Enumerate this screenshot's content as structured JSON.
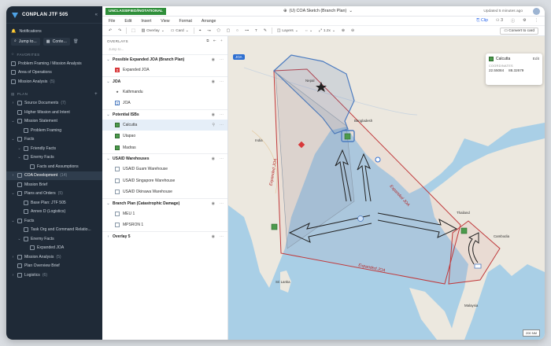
{
  "sidebar": {
    "title": "CONPLAN JTF 505",
    "notifications": "Notifications",
    "jump_to": "Jump to...",
    "context_btn": "Conte...",
    "favorites_label": "FAVORITES",
    "favorites": [
      {
        "label": "Problem Framing / Mission Analysis",
        "count": ""
      },
      {
        "label": "Area of Operations",
        "count": ""
      },
      {
        "label": "Mission Analysis",
        "count": "(5)"
      }
    ],
    "plan_label": "PLAN",
    "tree": [
      {
        "label": "Source Documents",
        "count": "(7)",
        "indent": 0,
        "chev": "›"
      },
      {
        "label": "Higher Mission and Intent",
        "count": "",
        "indent": 0,
        "chev": ""
      },
      {
        "label": "Mission Statement",
        "count": "",
        "indent": 0,
        "chev": "⌄"
      },
      {
        "label": "Problem Framing",
        "count": "",
        "indent": 1,
        "chev": ""
      },
      {
        "label": "Facts",
        "count": "",
        "indent": 0,
        "chev": "⌄"
      },
      {
        "label": "Friendly Facts",
        "count": "",
        "indent": 1,
        "chev": "⌄"
      },
      {
        "label": "Enemy Facts",
        "count": "",
        "indent": 1,
        "chev": "⌄"
      },
      {
        "label": "Facts and Assumptions",
        "count": "",
        "indent": 2,
        "chev": ""
      },
      {
        "label": "COA Development",
        "count": "(14)",
        "indent": 0,
        "chev": "›",
        "active": true
      },
      {
        "label": "Mission Brief",
        "count": "",
        "indent": 0,
        "chev": ""
      },
      {
        "label": "Plans and Orders",
        "count": "(5)",
        "indent": 0,
        "chev": "⌄"
      },
      {
        "label": "Base Plan: JTF 505",
        "count": "",
        "indent": 1,
        "chev": ""
      },
      {
        "label": "Annex D (Logistics)",
        "count": "",
        "indent": 1,
        "chev": ""
      },
      {
        "label": "Facts",
        "count": "",
        "indent": 0,
        "chev": "⌄"
      },
      {
        "label": "Task Org and Command Relatio...",
        "count": "",
        "indent": 1,
        "chev": ""
      },
      {
        "label": "Enemy Facts",
        "count": "",
        "indent": 1,
        "chev": "⌄"
      },
      {
        "label": "Expanded JOA",
        "count": "",
        "indent": 2,
        "chev": ""
      },
      {
        "label": "Mission Analysis",
        "count": "(5)",
        "indent": 0,
        "chev": "›"
      },
      {
        "label": "Plan Overview Brief",
        "count": "",
        "indent": 0,
        "chev": ""
      },
      {
        "label": "Logistics",
        "count": "(6)",
        "indent": 0,
        "chev": "›"
      }
    ]
  },
  "topbar": {
    "classification": "UNCLASSIFIED//NOTATIONAL",
    "doc_title": "(U) COA Sketch (Branch Plan)",
    "updated": "Updated 5 minutes ago"
  },
  "menu": {
    "items": [
      "File",
      "Edit",
      "Insert",
      "View",
      "Format",
      "Arrange"
    ],
    "clip": "Clip",
    "count": "3"
  },
  "toolbar": {
    "overlay": "Overlay",
    "card": "Card",
    "layers": "Layers",
    "zoom": "1.2x",
    "convert": "Convert to card"
  },
  "panel": {
    "title": "OVERLAYS",
    "search_placeholder": "Jump to...",
    "groups": [
      {
        "name": "Possible Expanded JOA (Branch Plan)",
        "items": [
          {
            "label": "Expanded JOA",
            "marker": "red"
          }
        ]
      },
      {
        "name": "JOA",
        "items": [
          {
            "label": "Kathmandu",
            "marker": "star"
          },
          {
            "label": "JOA",
            "marker": "blue"
          }
        ]
      },
      {
        "name": "Potential ISBs",
        "items": [
          {
            "label": "Calcutta",
            "marker": "green",
            "selected": true
          },
          {
            "label": "Utapao",
            "marker": "green"
          },
          {
            "label": "Madras",
            "marker": "green"
          }
        ]
      },
      {
        "name": "USAID Warehouses",
        "items": [
          {
            "label": "USAID Guam Warehouse",
            "marker": "gray"
          },
          {
            "label": "USAID Singapore Warehouse",
            "marker": "gray"
          },
          {
            "label": "USAID Okinawa Warehouse",
            "marker": "gray"
          }
        ]
      },
      {
        "name": "Branch Plan (Catastrophic Damage)",
        "items": [
          {
            "label": "MEU 1",
            "marker": "gray"
          },
          {
            "label": "MPSRON 1",
            "marker": "gray"
          }
        ]
      },
      {
        "name": "Overlay 5",
        "items": []
      }
    ]
  },
  "map": {
    "chip": "JOA",
    "card_title": "Calcutta",
    "card_edit": "Edit",
    "coords_label": "COORDINATES",
    "lat": "22.55084",
    "lon": "88.32679",
    "scale": "200 NM",
    "labels": {
      "expanded_joa": "Expanded JOA",
      "nepal": "Nepal",
      "bangladesh": "Bangladesh",
      "india": "India",
      "thailand": "Thailand",
      "cambodia": "Cambodia",
      "sri_lanka": "Sri Lanka",
      "malaysia": "Malaysia"
    }
  }
}
